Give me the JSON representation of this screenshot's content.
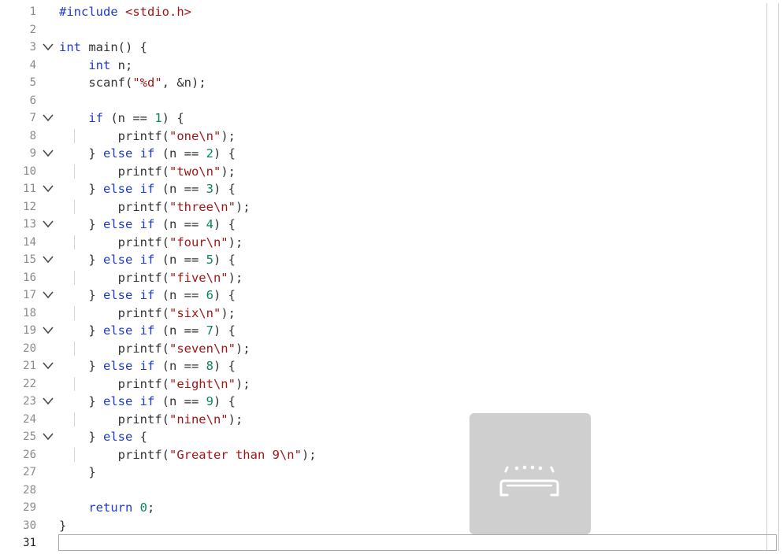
{
  "editor": {
    "lines": [
      {
        "n": "1",
        "tokens": [
          [
            "pp",
            "#include "
          ],
          [
            "inc",
            "<stdio.h>"
          ]
        ]
      },
      {
        "n": "2",
        "tokens": []
      },
      {
        "n": "3",
        "fold": true,
        "tokens": [
          [
            "kw",
            "int"
          ],
          [
            "p",
            " main() {"
          ]
        ]
      },
      {
        "n": "4",
        "tokens": [
          [
            "p",
            "    "
          ],
          [
            "kw",
            "int"
          ],
          [
            "p",
            " n;"
          ]
        ]
      },
      {
        "n": "5",
        "tokens": [
          [
            "p",
            "    scanf("
          ],
          [
            "str",
            "\"%d\""
          ],
          [
            "p",
            ", &n);"
          ]
        ]
      },
      {
        "n": "6",
        "tokens": []
      },
      {
        "n": "7",
        "fold": true,
        "tokens": [
          [
            "p",
            "    "
          ],
          [
            "kw",
            "if"
          ],
          [
            "p",
            " (n == "
          ],
          [
            "num",
            "1"
          ],
          [
            "p",
            ") {"
          ]
        ]
      },
      {
        "n": "8",
        "tokens": [
          [
            "p",
            "        printf("
          ],
          [
            "str",
            "\"one\\n\""
          ],
          [
            "p",
            ");"
          ]
        ]
      },
      {
        "n": "9",
        "fold": true,
        "tokens": [
          [
            "p",
            "    } "
          ],
          [
            "kw",
            "else if"
          ],
          [
            "p",
            " (n == "
          ],
          [
            "num",
            "2"
          ],
          [
            "p",
            ") {"
          ]
        ]
      },
      {
        "n": "10",
        "tokens": [
          [
            "p",
            "        printf("
          ],
          [
            "str",
            "\"two\\n\""
          ],
          [
            "p",
            ");"
          ]
        ]
      },
      {
        "n": "11",
        "fold": true,
        "tokens": [
          [
            "p",
            "    } "
          ],
          [
            "kw",
            "else if"
          ],
          [
            "p",
            " (n == "
          ],
          [
            "num",
            "3"
          ],
          [
            "p",
            ") {"
          ]
        ]
      },
      {
        "n": "12",
        "tokens": [
          [
            "p",
            "        printf("
          ],
          [
            "str",
            "\"three\\n\""
          ],
          [
            "p",
            ");"
          ]
        ]
      },
      {
        "n": "13",
        "fold": true,
        "tokens": [
          [
            "p",
            "    } "
          ],
          [
            "kw",
            "else if"
          ],
          [
            "p",
            " (n == "
          ],
          [
            "num",
            "4"
          ],
          [
            "p",
            ") {"
          ]
        ]
      },
      {
        "n": "14",
        "tokens": [
          [
            "p",
            "        printf("
          ],
          [
            "str",
            "\"four\\n\""
          ],
          [
            "p",
            ");"
          ]
        ]
      },
      {
        "n": "15",
        "fold": true,
        "tokens": [
          [
            "p",
            "    } "
          ],
          [
            "kw",
            "else if"
          ],
          [
            "p",
            " (n == "
          ],
          [
            "num",
            "5"
          ],
          [
            "p",
            ") {"
          ]
        ]
      },
      {
        "n": "16",
        "tokens": [
          [
            "p",
            "        printf("
          ],
          [
            "str",
            "\"five\\n\""
          ],
          [
            "p",
            ");"
          ]
        ]
      },
      {
        "n": "17",
        "fold": true,
        "tokens": [
          [
            "p",
            "    } "
          ],
          [
            "kw",
            "else if"
          ],
          [
            "p",
            " (n == "
          ],
          [
            "num",
            "6"
          ],
          [
            "p",
            ") {"
          ]
        ]
      },
      {
        "n": "18",
        "tokens": [
          [
            "p",
            "        printf("
          ],
          [
            "str",
            "\"six\\n\""
          ],
          [
            "p",
            ");"
          ]
        ]
      },
      {
        "n": "19",
        "fold": true,
        "tokens": [
          [
            "p",
            "    } "
          ],
          [
            "kw",
            "else if"
          ],
          [
            "p",
            " (n == "
          ],
          [
            "num",
            "7"
          ],
          [
            "p",
            ") {"
          ]
        ]
      },
      {
        "n": "20",
        "tokens": [
          [
            "p",
            "        printf("
          ],
          [
            "str",
            "\"seven\\n\""
          ],
          [
            "p",
            ");"
          ]
        ]
      },
      {
        "n": "21",
        "fold": true,
        "tokens": [
          [
            "p",
            "    } "
          ],
          [
            "kw",
            "else if"
          ],
          [
            "p",
            " (n == "
          ],
          [
            "num",
            "8"
          ],
          [
            "p",
            ") {"
          ]
        ]
      },
      {
        "n": "22",
        "tokens": [
          [
            "p",
            "        printf("
          ],
          [
            "str",
            "\"eight\\n\""
          ],
          [
            "p",
            ");"
          ]
        ]
      },
      {
        "n": "23",
        "fold": true,
        "tokens": [
          [
            "p",
            "    } "
          ],
          [
            "kw",
            "else if"
          ],
          [
            "p",
            " (n == "
          ],
          [
            "num",
            "9"
          ],
          [
            "p",
            ") {"
          ]
        ]
      },
      {
        "n": "24",
        "tokens": [
          [
            "p",
            "        printf("
          ],
          [
            "str",
            "\"nine\\n\""
          ],
          [
            "p",
            ");"
          ]
        ]
      },
      {
        "n": "25",
        "fold": true,
        "tokens": [
          [
            "p",
            "    } "
          ],
          [
            "kw",
            "else"
          ],
          [
            "p",
            " {"
          ]
        ]
      },
      {
        "n": "26",
        "tokens": [
          [
            "p",
            "        printf("
          ],
          [
            "str",
            "\"Greater than 9\\n\""
          ],
          [
            "p",
            ");"
          ]
        ]
      },
      {
        "n": "27",
        "tokens": [
          [
            "p",
            "    }"
          ]
        ]
      },
      {
        "n": "28",
        "tokens": []
      },
      {
        "n": "29",
        "tokens": [
          [
            "p",
            "    "
          ],
          [
            "kw",
            "return"
          ],
          [
            "p",
            " "
          ],
          [
            "num",
            "0"
          ],
          [
            "p",
            ";"
          ]
        ]
      },
      {
        "n": "30",
        "tokens": [
          [
            "p",
            "}"
          ]
        ]
      },
      {
        "n": "31",
        "current": true,
        "tokens": []
      }
    ]
  },
  "colors": {
    "keyword": "#1d3ad0",
    "string": "#a31515",
    "number": "#098658",
    "text": "#333333",
    "gutter": "#8a8a8a",
    "overlay": "#cfcfcf"
  },
  "overlay": {
    "icon": "keyboard-hide-icon"
  }
}
